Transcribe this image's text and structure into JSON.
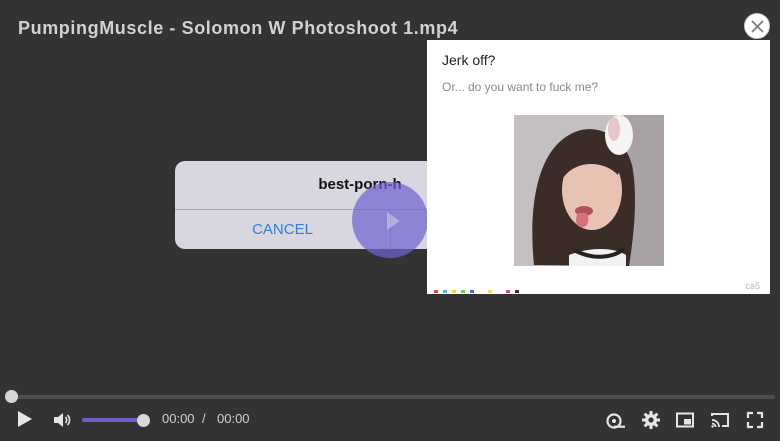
{
  "video": {
    "title": "PumpingMuscle - Solomon W Photoshoot 1.mp4",
    "progress": 0,
    "volume": 1.0
  },
  "dialog": {
    "title": "best-porn-h",
    "cancel_label": "CANCEL"
  },
  "ad": {
    "heading": "Jerk off?",
    "subtext": "Or... do you want to fuck me?",
    "code": "ca5",
    "image_icon": "photo-of-woman-icon"
  },
  "controls": {
    "current_time": "00:00",
    "separator": "/",
    "duration": "00:00",
    "icons": [
      "play-icon",
      "volume-icon",
      "subtitles-icon",
      "settings-icon",
      "picture-in-picture-icon",
      "cast-icon",
      "fullscreen-icon"
    ]
  },
  "colors": {
    "background": "#333333",
    "accent": "#6a5fc7",
    "link": "#2f7fe0"
  }
}
